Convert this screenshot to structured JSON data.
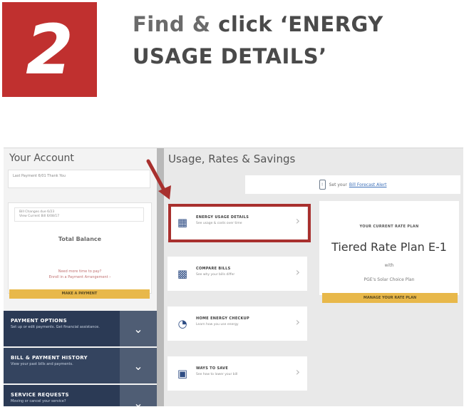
{
  "step": {
    "number": "2",
    "title_plain": "Find & ",
    "title_emph": "click ‘ENERGY USAGE DETAILS’"
  },
  "account": {
    "heading": "Your Account",
    "last_payment": "Last Payment 6/01 Thank You",
    "alert_line1": "Bill Changes due 6/23",
    "alert_line2": "View Current Bill 6/08/17",
    "total_label": "Total Balance",
    "help_line1": "Need more time to pay?",
    "help_line2": "Enroll in a Payment Arrangement ›",
    "pay_button": "MAKE A PAYMENT",
    "nav": [
      {
        "title": "PAYMENT OPTIONS",
        "sub": "Set up or edit payments. Get financial assistance."
      },
      {
        "title": "BILL & PAYMENT HISTORY",
        "sub": "View your past bills and payments."
      },
      {
        "title": "SERVICE REQUESTS",
        "sub": "Moving or cancel your service?"
      }
    ]
  },
  "usage": {
    "heading": "Usage, Rates & Savings",
    "banner_text": "Set your",
    "banner_link": "Bill Forecast Alert",
    "options": [
      {
        "title": "ENERGY USAGE DETAILS",
        "sub": "See usage & costs over time"
      },
      {
        "title": "COMPARE BILLS",
        "sub": "See why your bills differ"
      },
      {
        "title": "HOME ENERGY CHECKUP",
        "sub": "Learn how you use energy"
      },
      {
        "title": "WAYS TO SAVE",
        "sub": "See how to lower your bill"
      }
    ],
    "plan": {
      "caption": "YOUR CURRENT RATE PLAN",
      "name": "Tiered Rate Plan E-1",
      "with": "with",
      "solar": "PGE's Solar Choice Plan",
      "button": "MANAGE YOUR RATE PLAN"
    }
  },
  "colors": {
    "accent_red": "#c0302f",
    "highlight_red": "#a8302e",
    "gold": "#e8b84a",
    "navy": "#2b3a55"
  }
}
